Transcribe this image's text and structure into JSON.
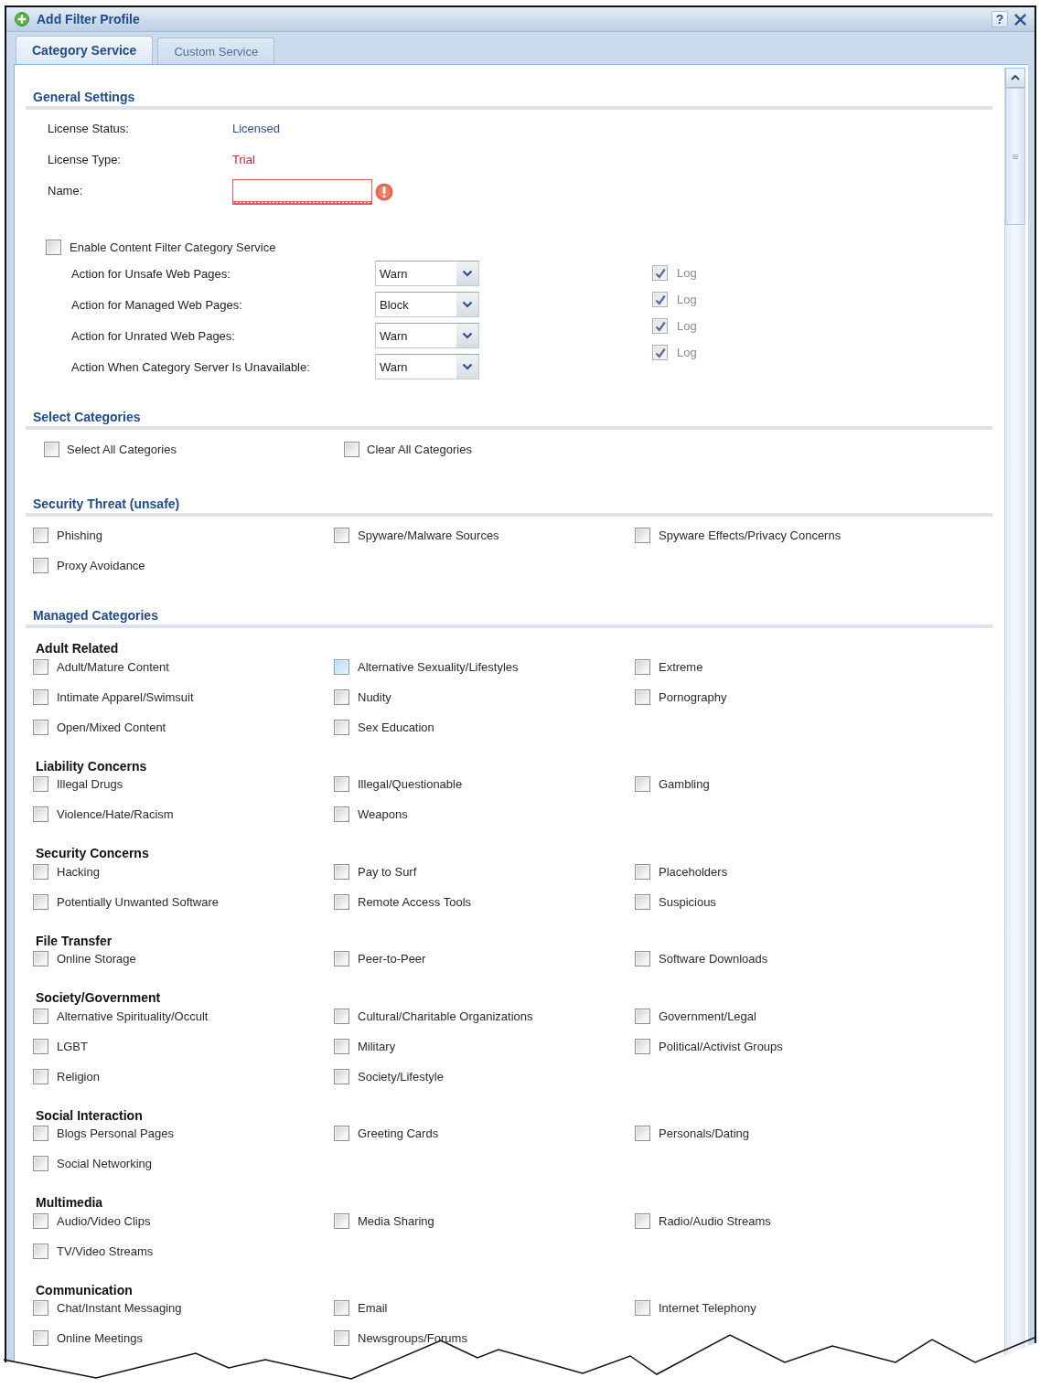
{
  "window": {
    "title": "Add Filter Profile",
    "help": "?"
  },
  "tabs": [
    {
      "label": "Category Service",
      "selected": true
    },
    {
      "label": "Custom Service",
      "selected": false
    }
  ],
  "general_settings": {
    "heading": "General Settings",
    "fields": [
      {
        "kind": "text",
        "label": "License Status:",
        "value": "Licensed",
        "color": "#2d4f8e"
      },
      {
        "kind": "text",
        "label": "License Type:",
        "value": "Trial",
        "color": "#c62a2a"
      },
      {
        "kind": "input",
        "label": "Name:",
        "invalid": true
      }
    ]
  },
  "enable_category_service": {
    "label": "Enable Content Filter Category Service",
    "checked": false
  },
  "actions": [
    {
      "label": "Action for Unsafe Web Pages:",
      "value": "Warn"
    },
    {
      "label": "Action for Managed Web Pages:",
      "value": "Block"
    },
    {
      "label": "Action for Unrated Web Pages:",
      "value": "Warn"
    },
    {
      "label": "Action When Category Server Is Unavailable:",
      "value": "Warn"
    }
  ],
  "log_options": [
    {
      "label": "Log",
      "checked": true,
      "disabled": true
    },
    {
      "label": "Log",
      "checked": true,
      "disabled": true
    },
    {
      "label": "Log",
      "checked": true,
      "disabled": true
    },
    {
      "label": "Log",
      "checked": true,
      "disabled": true
    }
  ],
  "select_categories": {
    "heading": "Select Categories",
    "options": [
      {
        "label": "Select All Categories",
        "checked": false
      },
      {
        "label": "Clear All Categories",
        "checked": false
      }
    ]
  },
  "security_threat": {
    "heading": "Security Threat (unsafe)",
    "items": [
      {
        "label": "Phishing",
        "checked": false,
        "hovered": false
      },
      {
        "label": "Spyware/Malware Sources",
        "checked": false,
        "hovered": false
      },
      {
        "label": "Spyware Effects/Privacy Concerns",
        "checked": false,
        "hovered": false
      },
      {
        "label": "Proxy Avoidance",
        "checked": false,
        "hovered": false
      }
    ]
  },
  "managed_categories": {
    "heading": "Managed Categories",
    "groups": [
      {
        "title": "Adult Related",
        "items": [
          {
            "label": "Adult/Mature Content",
            "checked": false,
            "hovered": false
          },
          {
            "label": "Alternative Sexuality/Lifestyles",
            "checked": false,
            "hovered": true
          },
          {
            "label": "Extreme",
            "checked": false,
            "hovered": false
          },
          {
            "label": "Intimate Apparel/Swimsuit",
            "checked": false,
            "hovered": false
          },
          {
            "label": "Nudity",
            "checked": false,
            "hovered": false
          },
          {
            "label": "Pornography",
            "checked": false,
            "hovered": false
          },
          {
            "label": "Open/Mixed Content",
            "checked": false,
            "hovered": false
          },
          {
            "label": "Sex Education",
            "checked": false,
            "hovered": false
          }
        ]
      },
      {
        "title": "Liability Concerns",
        "items": [
          {
            "label": "Illegal Drugs",
            "checked": false,
            "hovered": false
          },
          {
            "label": "Illegal/Questionable",
            "checked": false,
            "hovered": false
          },
          {
            "label": "Gambling",
            "checked": false,
            "hovered": false
          },
          {
            "label": "Violence/Hate/Racism",
            "checked": false,
            "hovered": false
          },
          {
            "label": "Weapons",
            "checked": false,
            "hovered": false
          }
        ]
      },
      {
        "title": "Security Concerns",
        "items": [
          {
            "label": "Hacking",
            "checked": false,
            "hovered": false
          },
          {
            "label": "Pay to Surf",
            "checked": false,
            "hovered": false
          },
          {
            "label": "Placeholders",
            "checked": false,
            "hovered": false
          },
          {
            "label": "Potentially Unwanted Software",
            "checked": false,
            "hovered": false
          },
          {
            "label": "Remote Access Tools",
            "checked": false,
            "hovered": false
          },
          {
            "label": "Suspicious",
            "checked": false,
            "hovered": false
          }
        ]
      },
      {
        "title": "File Transfer",
        "items": [
          {
            "label": "Online Storage",
            "checked": false,
            "hovered": false
          },
          {
            "label": "Peer-to-Peer",
            "checked": false,
            "hovered": false
          },
          {
            "label": "Software Downloads",
            "checked": false,
            "hovered": false
          }
        ]
      },
      {
        "title": "Society/Government",
        "items": [
          {
            "label": "Alternative Spirituality/Occult",
            "checked": false,
            "hovered": false
          },
          {
            "label": "Cultural/Charitable Organizations",
            "checked": false,
            "hovered": false
          },
          {
            "label": "Government/Legal",
            "checked": false,
            "hovered": false
          },
          {
            "label": "LGBT",
            "checked": false,
            "hovered": false
          },
          {
            "label": "Military",
            "checked": false,
            "hovered": false
          },
          {
            "label": "Political/Activist Groups",
            "checked": false,
            "hovered": false
          },
          {
            "label": "Religion",
            "checked": false,
            "hovered": false
          },
          {
            "label": "Society/Lifestyle",
            "checked": false,
            "hovered": false
          }
        ]
      },
      {
        "title": "Social Interaction",
        "items": [
          {
            "label": "Blogs Personal Pages",
            "checked": false,
            "hovered": false
          },
          {
            "label": "Greeting Cards",
            "checked": false,
            "hovered": false
          },
          {
            "label": "Personals/Dating",
            "checked": false,
            "hovered": false
          },
          {
            "label": "Social Networking",
            "checked": false,
            "hovered": false
          }
        ]
      },
      {
        "title": "Multimedia",
        "items": [
          {
            "label": "Audio/Video Clips",
            "checked": false,
            "hovered": false
          },
          {
            "label": "Media Sharing",
            "checked": false,
            "hovered": false
          },
          {
            "label": "Radio/Audio Streams",
            "checked": false,
            "hovered": false
          },
          {
            "label": "TV/Video Streams",
            "checked": false,
            "hovered": false
          }
        ]
      },
      {
        "title": "Communication",
        "items": [
          {
            "label": "Chat/Instant Messaging",
            "checked": false,
            "hovered": false
          },
          {
            "label": "Email",
            "checked": false,
            "hovered": false
          },
          {
            "label": "Internet Telephony",
            "checked": false,
            "hovered": false
          },
          {
            "label": "Online Meetings",
            "checked": false,
            "hovered": false
          },
          {
            "label": "Newsgroups/Forums",
            "checked": false,
            "hovered": false
          }
        ]
      }
    ]
  }
}
